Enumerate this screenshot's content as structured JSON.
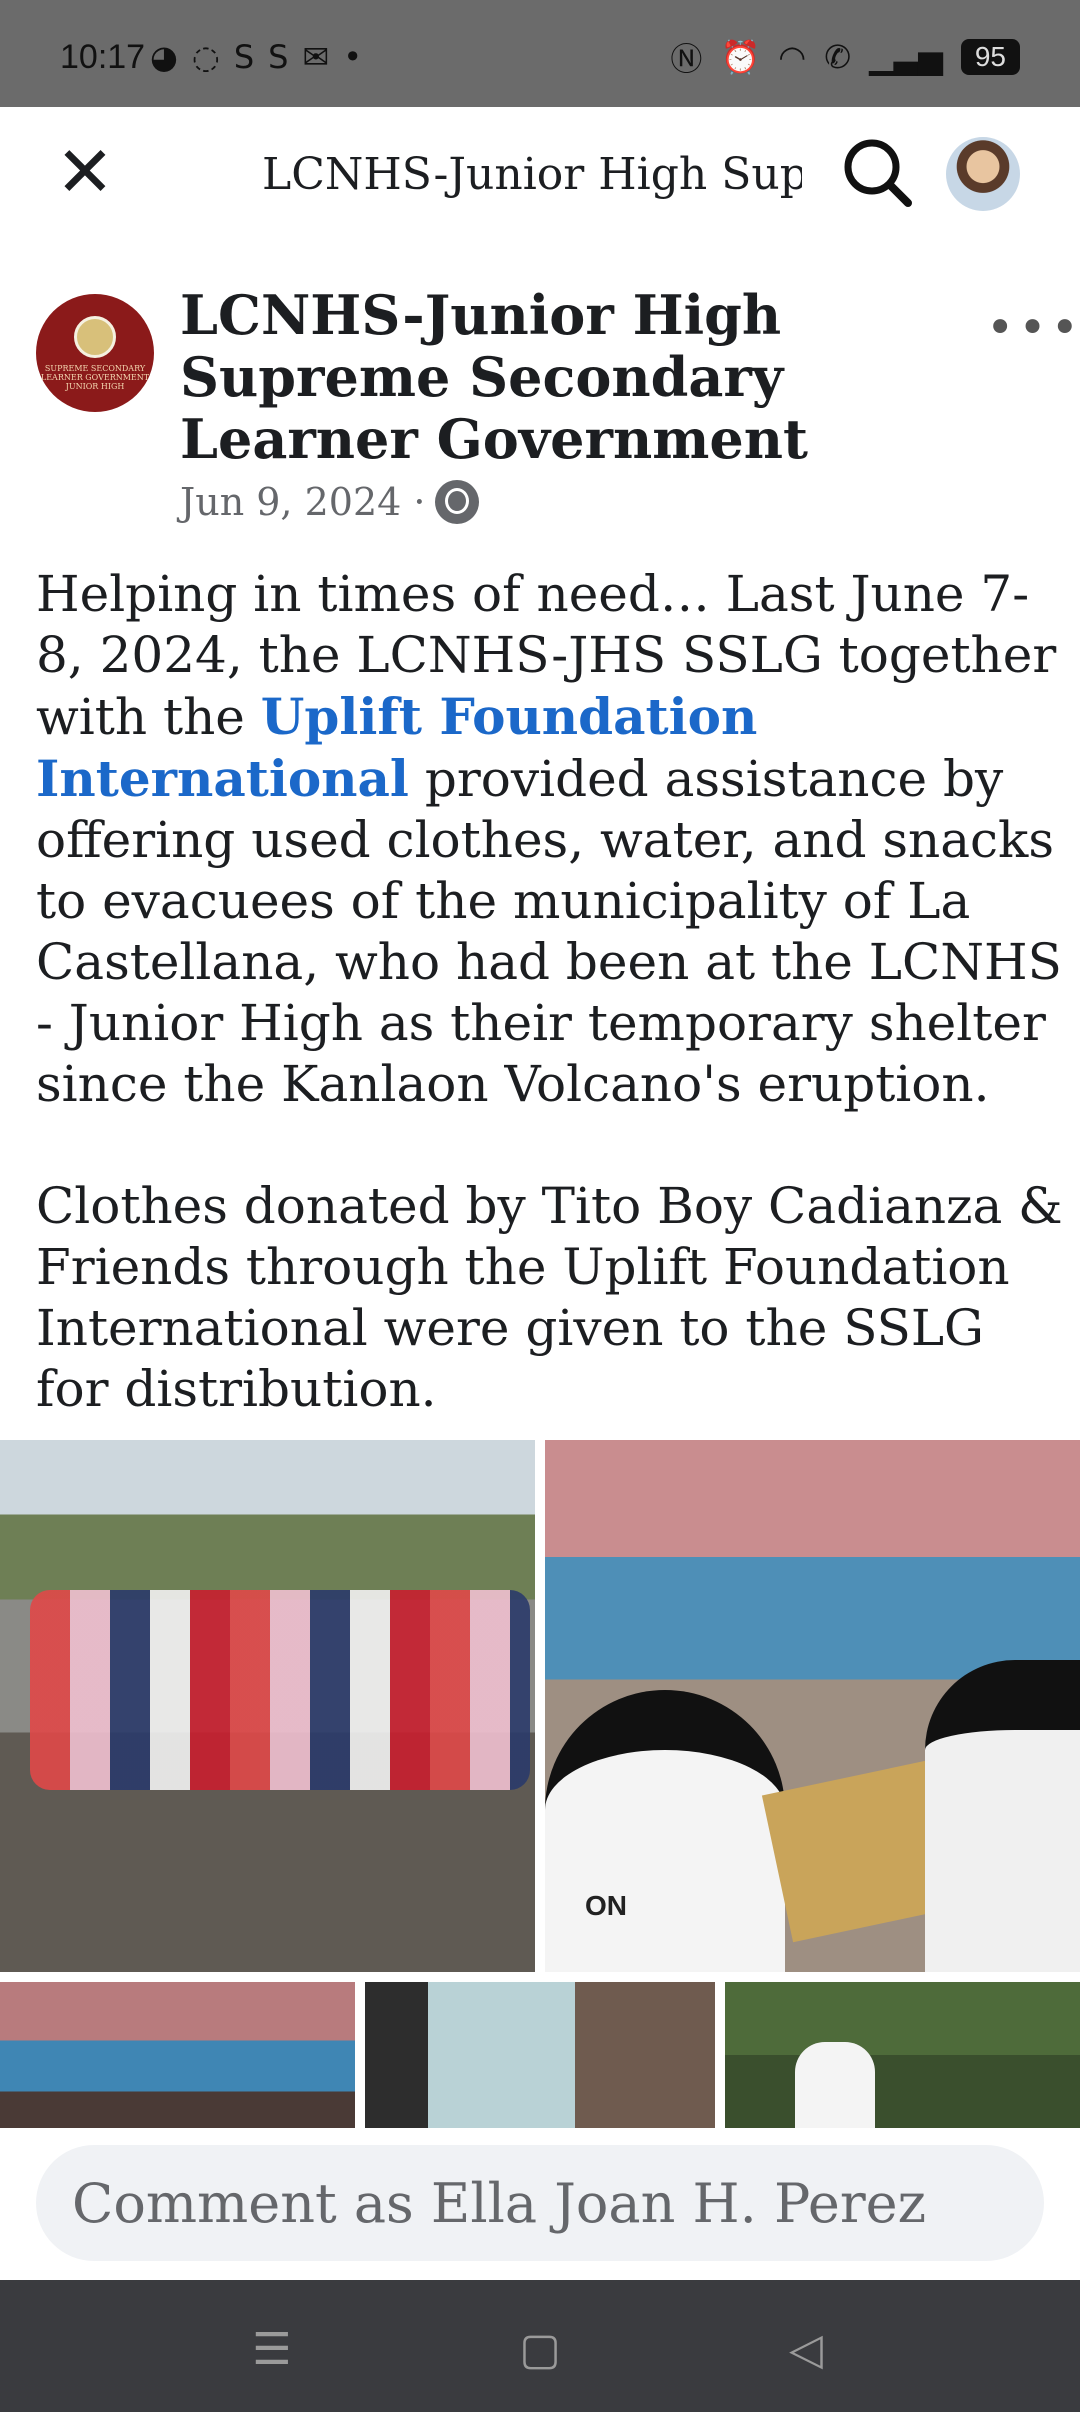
{
  "status_bar": {
    "time": "10:17",
    "left_icons": [
      "messenger-icon",
      "viber-icon",
      "s-icon",
      "s-icon",
      "mail-icon",
      "dot-icon"
    ],
    "battery": "95"
  },
  "top_bar": {
    "title": "LCNHS-Junior High Supre..."
  },
  "post": {
    "page_name": "LCNHS-Junior High Supreme Secondary Learner Government",
    "date": "Jun 9, 2024 ·",
    "logo_text": "SUPREME SECONDARY LEARNER GOVERNMENT JUNIOR HIGH",
    "text_part1": "Helping in times of need… Last June 7-8, 2024, the LCNHS-JHS SSLG together with the ",
    "link_text": "Uplift Foundation International",
    "text_part2": " provided assistance by offering used clothes, water, and snacks to evacuees of the municipality of La Castellana, who had been at the LCNHS - Junior High as their temporary shelter since the Kanlaon Volcano's eruption.",
    "paragraph2": "Clothes donated by Tito Boy Cadianza & Friends through the Uplift Foundation International were given to the SSLG for distribution.",
    "photo2_shirt_text": "ON"
  },
  "comment": {
    "placeholder": "Comment as Ella Joan H. Perez"
  },
  "colors": {
    "link": "#1b68c9",
    "status_bar_bg": "#6b6b6b",
    "nav_bar_bg": "#3a3b3f"
  }
}
